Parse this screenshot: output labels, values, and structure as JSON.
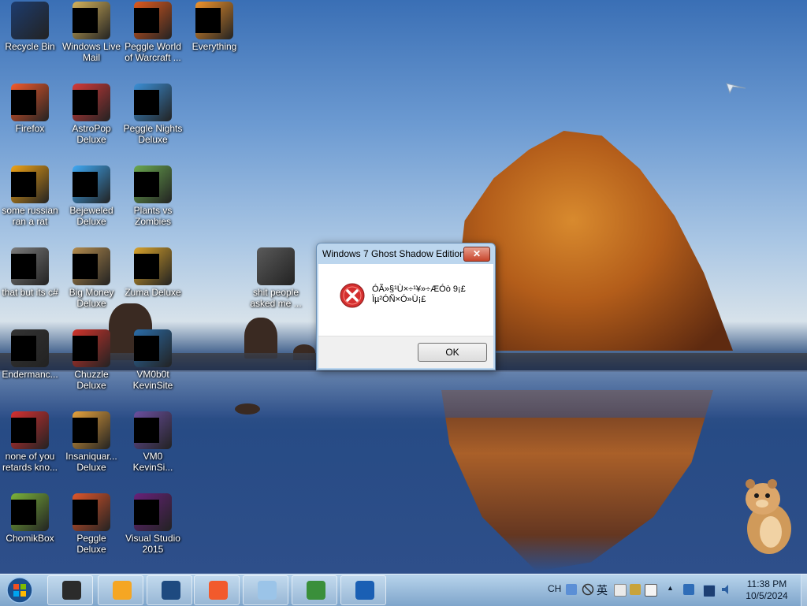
{
  "desktop_icons": [
    {
      "label": "Recycle Bin",
      "color": "#1d3c6e",
      "masked": false
    },
    {
      "label": "Windows Live\nMail",
      "color": "#d5b35a",
      "masked": true
    },
    {
      "label": "Peggle World\nof Warcraft ...",
      "color": "#e05a1e",
      "masked": true
    },
    {
      "label": "Everything",
      "color": "#f0932b",
      "masked": true
    },
    {
      "label": "Firefox",
      "color": "#f25a2c",
      "masked": true
    },
    {
      "label": "AstroPop\nDeluxe",
      "color": "#d43a3a",
      "masked": true
    },
    {
      "label": "Peggle Nights\nDeluxe",
      "color": "#3b8fd6",
      "masked": true
    },
    {
      "label": "some russian\nran a rat",
      "color": "#f0a316",
      "masked": true
    },
    {
      "label": "Bejeweled\nDeluxe",
      "color": "#3fa9f5",
      "masked": true
    },
    {
      "label": "Plants vs\nZombies",
      "color": "#6aa84f",
      "masked": true
    },
    {
      "label": "that but its c#",
      "color": "#7a7a7a",
      "masked": true
    },
    {
      "label": "Big Money\nDeluxe",
      "color": "#b38b4d",
      "masked": true
    },
    {
      "label": "Zuma Deluxe",
      "color": "#d8a22b",
      "masked": true
    },
    {
      "label": "shit people\nasked me ...",
      "color": "#5a5a5a",
      "masked": false
    },
    {
      "label": "Endermanc...",
      "color": "#333333",
      "masked": true
    },
    {
      "label": "Chuzzle\nDeluxe",
      "color": "#d0332b",
      "masked": true
    },
    {
      "label": "VM0b0t\nKevinSite",
      "color": "#2a6ca8",
      "masked": true
    },
    {
      "label": "none of you\nretards kno...",
      "color": "#d63031",
      "masked": true
    },
    {
      "label": "Insaniquar...\nDeluxe",
      "color": "#e6a23c",
      "masked": true
    },
    {
      "label": "VM0\nKevinSi...",
      "color": "#6b4fa0",
      "masked": true
    },
    {
      "label": "ChomikBox",
      "color": "#7bb33a",
      "masked": true
    },
    {
      "label": "Peggle Deluxe",
      "color": "#e0562b",
      "masked": true
    },
    {
      "label": "Visual Studio\n2015",
      "color": "#68217a",
      "masked": true
    }
  ],
  "dialog": {
    "title": "Windows 7 Ghost Shadow Edition",
    "close_label": "✕",
    "message_line1": "ÓÃ»§¹Ù×÷¹¥»÷ÆÓò 9¡£",
    "message_line2": "Ïµ²ÓÑ×Ó»Ù¡£",
    "ok_label": "OK",
    "icon": "error-icon"
  },
  "taskbar": {
    "start_icon": "windows-start-orb",
    "buttons": [
      {
        "name": "taskbar-explorer",
        "icon": "folder-icon",
        "color": "#2b2b2b"
      },
      {
        "name": "taskbar-media-player",
        "icon": "media-player-icon",
        "color": "#f5a623"
      },
      {
        "name": "taskbar-globe",
        "icon": "globe-icon",
        "color": "#1e4a80"
      },
      {
        "name": "taskbar-firefox",
        "icon": "firefox-icon",
        "color": "#f25a2c"
      },
      {
        "name": "taskbar-paint",
        "icon": "paint-icon",
        "color": "#9bc4e8"
      },
      {
        "name": "taskbar-checklist",
        "icon": "checklist-icon",
        "color": "#3a8f3a"
      },
      {
        "name": "taskbar-tablet",
        "icon": "tablet-icon",
        "color": "#1a5fb4"
      }
    ],
    "language": "CH",
    "ime_char": "英",
    "clock_time": "11:38 PM",
    "clock_date": "10/5/2024"
  }
}
